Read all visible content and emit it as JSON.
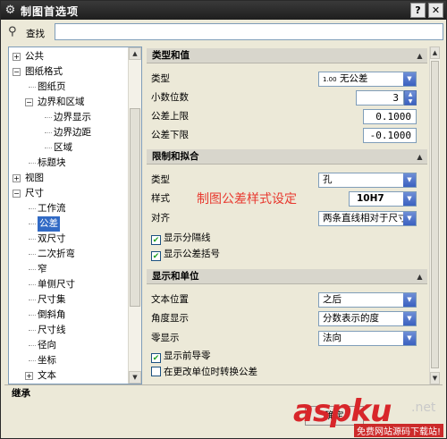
{
  "window": {
    "title": "制图首选项",
    "icon": "gear-icon"
  },
  "title_buttons": {
    "help": "?",
    "close": "✕"
  },
  "search": {
    "label": "查找",
    "value": ""
  },
  "tree": [
    {
      "label": "公共",
      "level": 0,
      "expander": "+"
    },
    {
      "label": "图纸格式",
      "level": 0,
      "expander": "−"
    },
    {
      "label": "图纸页",
      "level": 1,
      "expander": ""
    },
    {
      "label": "边界和区域",
      "level": 1,
      "expander": "−"
    },
    {
      "label": "边界显示",
      "level": 2,
      "expander": ""
    },
    {
      "label": "边界边距",
      "level": 2,
      "expander": ""
    },
    {
      "label": "区域",
      "level": 2,
      "expander": ""
    },
    {
      "label": "标题块",
      "level": 1,
      "expander": ""
    },
    {
      "label": "视图",
      "level": 0,
      "expander": "+"
    },
    {
      "label": "尺寸",
      "level": 0,
      "expander": "−"
    },
    {
      "label": "工作流",
      "level": 1,
      "expander": ""
    },
    {
      "label": "公差",
      "level": 1,
      "expander": "",
      "selected": true
    },
    {
      "label": "双尺寸",
      "level": 1,
      "expander": ""
    },
    {
      "label": "二次折弯",
      "level": 1,
      "expander": ""
    },
    {
      "label": "窄",
      "level": 1,
      "expander": ""
    },
    {
      "label": "单侧尺寸",
      "level": 1,
      "expander": ""
    },
    {
      "label": "尺寸集",
      "level": 1,
      "expander": ""
    },
    {
      "label": "倒斜角",
      "level": 1,
      "expander": ""
    },
    {
      "label": "尺寸线",
      "level": 1,
      "expander": ""
    },
    {
      "label": "径向",
      "level": 1,
      "expander": ""
    },
    {
      "label": "坐标",
      "level": 1,
      "expander": ""
    },
    {
      "label": "文本",
      "level": 1,
      "expander": "+"
    }
  ],
  "sections": {
    "type_value": {
      "header": "类型和值",
      "type_label": "类型",
      "type_value": "无公差",
      "type_prefix": "1.00",
      "decimals_label": "小数位数",
      "decimals_value": "3",
      "upper_label": "公差上限",
      "upper_value": "0.1000",
      "lower_label": "公差下限",
      "lower_value": "-0.1000"
    },
    "limit_fit": {
      "header": "限制和拟合",
      "type_label": "类型",
      "type_value": "孔",
      "style_label": "样式",
      "style_value": "10H7",
      "align_label": "对齐",
      "align_value": "两条直线相对于尺寸",
      "show_separator_label": "显示分隔线",
      "show_separator_checked": true,
      "show_brackets_label": "显示公差括号",
      "show_brackets_checked": true
    },
    "display_units": {
      "header": "显示和单位",
      "text_pos_label": "文本位置",
      "text_pos_value": "之后",
      "angle_label": "角度显示",
      "angle_value": "分数表示的度",
      "zero_label": "零显示",
      "zero_value": "法向",
      "leading_zero_label": "显示前导零",
      "leading_zero_checked": true,
      "convert_label": "在更改单位时转换公差",
      "convert_checked": false
    }
  },
  "annotation": "制图公差样式设定",
  "inherit_label": "继承",
  "ok_label": "确定",
  "watermark": {
    "brand": "aspku",
    "tld": ".net",
    "tagline": "免费网站源码下载站!"
  },
  "colors": {
    "titlebar": "#2a2a2a",
    "selection": "#316ac5",
    "annotation": "#e8392f",
    "watermark": "#d8262a"
  }
}
